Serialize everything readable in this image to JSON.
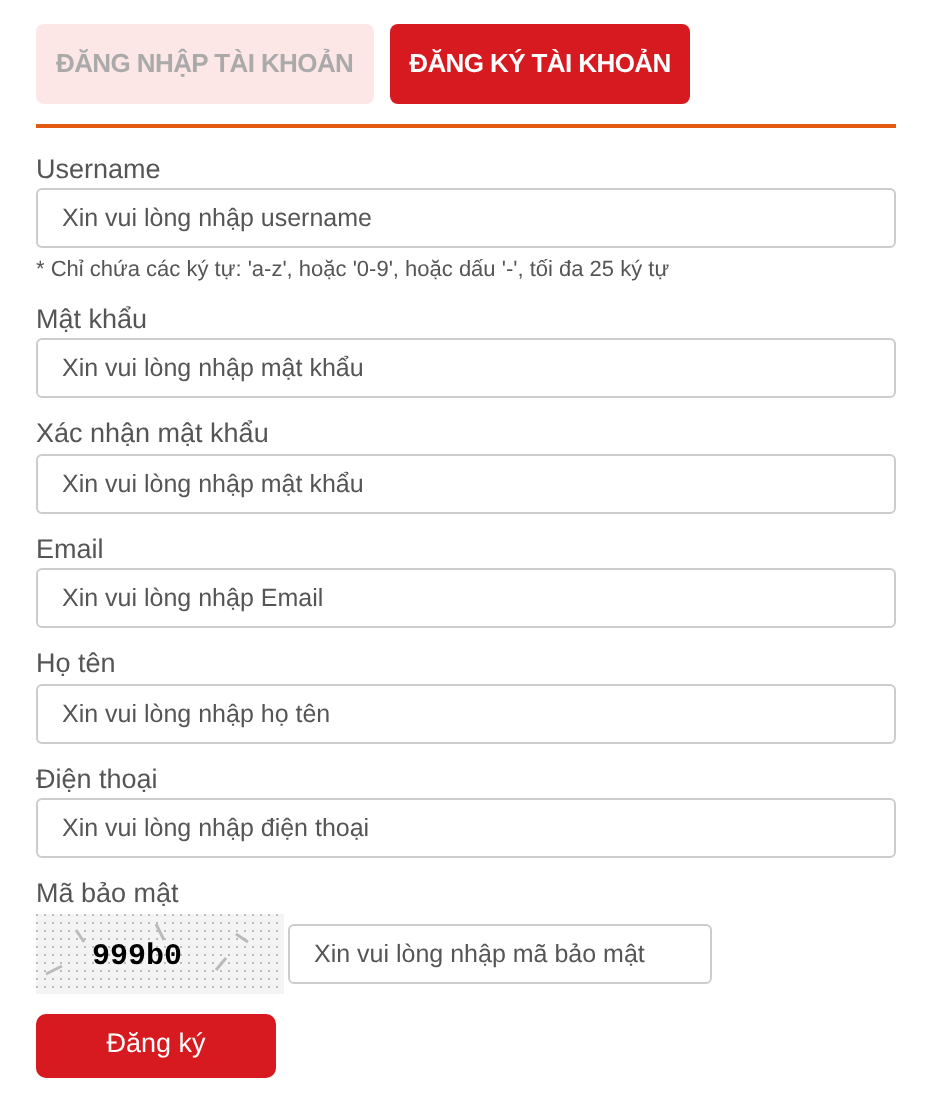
{
  "tabs": [
    {
      "label": "ĐĂNG NHẬP TÀI KHOẢN",
      "selected": false
    },
    {
      "label": "ĐĂNG KÝ TÀI KHOẢN",
      "selected": true
    }
  ],
  "fields": [
    {
      "label": "Username",
      "placeholder": "Xin vui lòng nhập username",
      "hint": "* Chỉ chứa các ký tự: 'a-z', hoặc '0-9', hoặc dấu '-', tối đa 25 ký tự"
    },
    {
      "label": "Mật khẩu",
      "placeholder": "Xin vui lòng nhập mật khẩu"
    },
    {
      "label": "Xác nhận mật khẩu",
      "placeholder": "Xin vui lòng nhập mật khẩu"
    },
    {
      "label": "Email",
      "placeholder": "Xin vui lòng nhập Email"
    },
    {
      "label": "Họ tên",
      "placeholder": "Xin vui lòng nhập họ tên"
    },
    {
      "label": "Điện thoại",
      "placeholder": "Xin vui lòng nhập điện thoại"
    }
  ],
  "captcha": {
    "label": "Mã bảo mật",
    "code": "999b0",
    "placeholder": "Xin vui lòng nhập mã bảo mật"
  },
  "submit": "Đăng ký"
}
